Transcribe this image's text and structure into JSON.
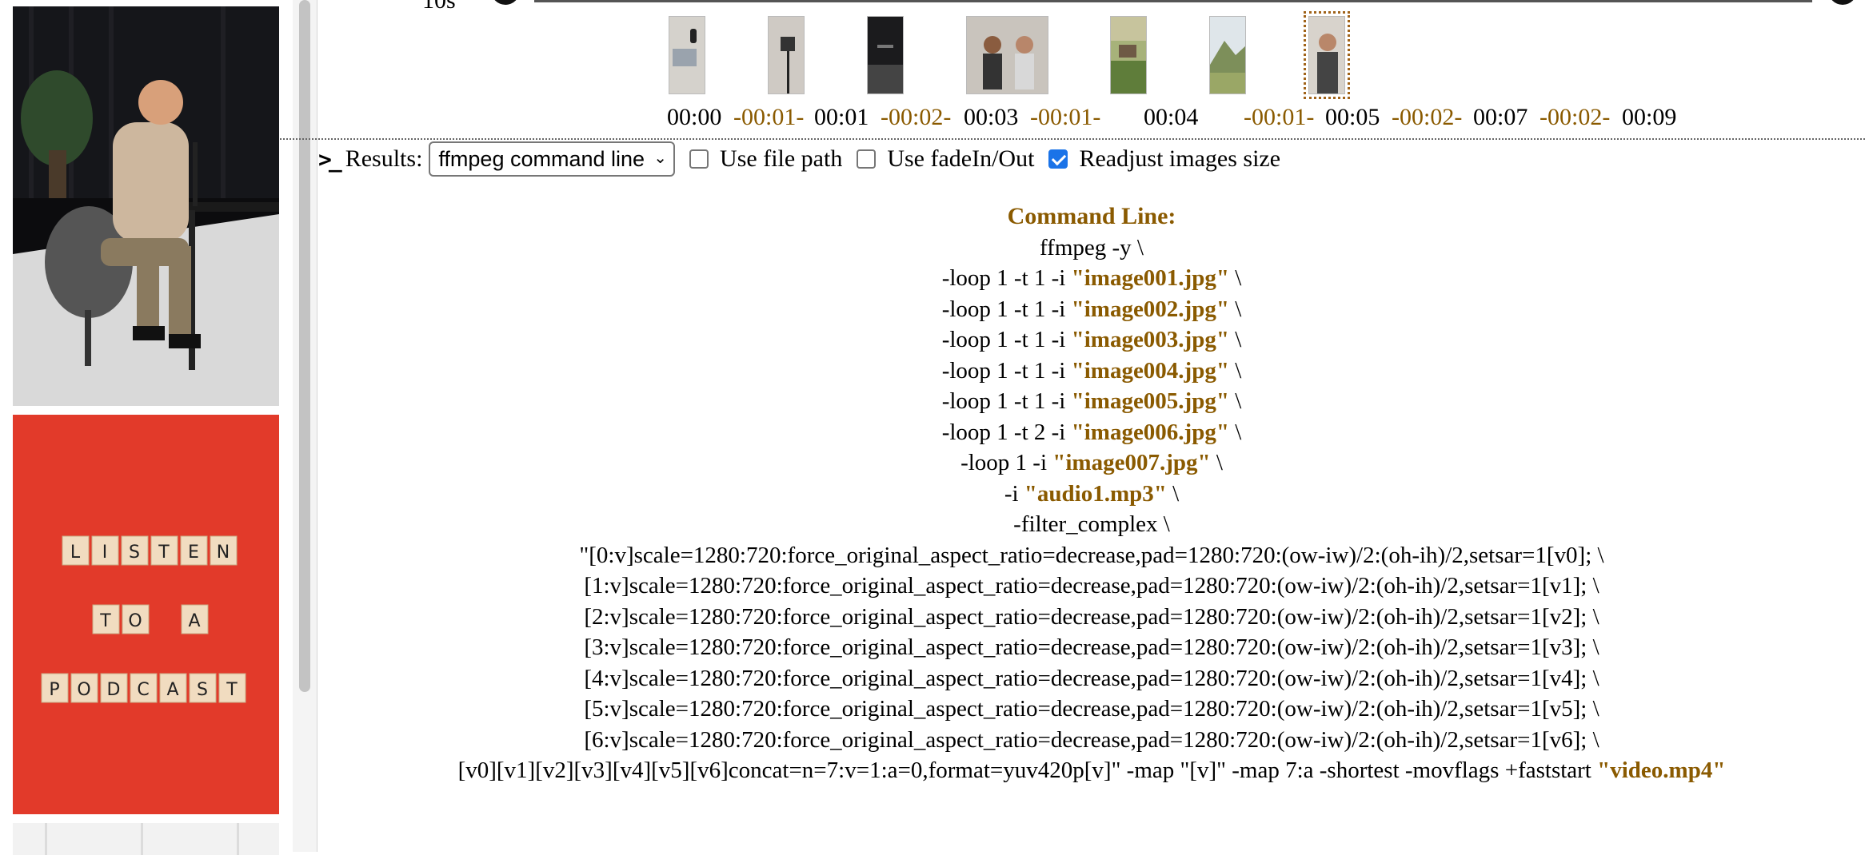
{
  "gallery": {
    "photos": [
      {
        "icon": "podcaster-photo"
      },
      {
        "icon": "listen-to-a-podcast-tiles-photo",
        "tile_rows": [
          [
            "L",
            "I",
            "S",
            "T",
            "E",
            "N"
          ],
          [
            "T",
            "O",
            "",
            "A"
          ],
          [
            "P",
            "O",
            "D",
            "C",
            "A",
            "S",
            "T"
          ]
        ]
      },
      {
        "icon": "partial-photo"
      }
    ]
  },
  "timeline": {
    "ruler_label": "10s",
    "clips": [
      {
        "time": "00:00",
        "dur": "-00:01-"
      },
      {
        "time": "00:01",
        "dur": "-00:02-"
      },
      {
        "time": "00:03",
        "dur": "-00:01-"
      },
      {
        "time": "00:04",
        "dur": "-00:01-"
      },
      {
        "time": "00:05",
        "dur": "-00:02-"
      },
      {
        "time": "00:07",
        "dur": "-00:02-"
      },
      {
        "time": "00:09",
        "dur": ""
      }
    ],
    "selected_index": 6
  },
  "toolbar": {
    "results_label": "Results:",
    "select_value": "ffmpeg command line",
    "use_file_path": {
      "label": "Use file path",
      "checked": false
    },
    "use_fade": {
      "label": "Use fadeIn/Out",
      "checked": false
    },
    "readjust": {
      "label": "Readjust images size",
      "checked": true
    }
  },
  "command": {
    "title": "Command Line:",
    "l_ffmpeg": "ffmpeg -y \\",
    "inputs": [
      {
        "pre": "-loop 1 -t 1 -i ",
        "file": "\"image001.jpg\"",
        "post": " \\"
      },
      {
        "pre": "-loop 1 -t 1 -i ",
        "file": "\"image002.jpg\"",
        "post": " \\"
      },
      {
        "pre": "-loop 1 -t 1 -i ",
        "file": "\"image003.jpg\"",
        "post": " \\"
      },
      {
        "pre": "-loop 1 -t 1 -i ",
        "file": "\"image004.jpg\"",
        "post": " \\"
      },
      {
        "pre": "-loop 1 -t 1 -i ",
        "file": "\"image005.jpg\"",
        "post": " \\"
      },
      {
        "pre": "-loop 1 -t 2 -i ",
        "file": "\"image006.jpg\"",
        "post": " \\"
      },
      {
        "pre": "-loop 1 -i ",
        "file": "\"image007.jpg\"",
        "post": " \\"
      },
      {
        "pre": "-i ",
        "file": "\"audio1.mp3\"",
        "post": " \\"
      }
    ],
    "l_filter": "-filter_complex \\",
    "filters": [
      "\"[0:v]scale=1280:720:force_original_aspect_ratio=decrease,pad=1280:720:(ow-iw)/2:(oh-ih)/2,setsar=1[v0]; \\",
      "[1:v]scale=1280:720:force_original_aspect_ratio=decrease,pad=1280:720:(ow-iw)/2:(oh-ih)/2,setsar=1[v1]; \\",
      "[2:v]scale=1280:720:force_original_aspect_ratio=decrease,pad=1280:720:(ow-iw)/2:(oh-ih)/2,setsar=1[v2]; \\",
      "[3:v]scale=1280:720:force_original_aspect_ratio=decrease,pad=1280:720:(ow-iw)/2:(oh-ih)/2,setsar=1[v3]; \\",
      "[4:v]scale=1280:720:force_original_aspect_ratio=decrease,pad=1280:720:(ow-iw)/2:(oh-ih)/2,setsar=1[v4]; \\",
      "[5:v]scale=1280:720:force_original_aspect_ratio=decrease,pad=1280:720:(ow-iw)/2:(oh-ih)/2,setsar=1[v5]; \\",
      "[6:v]scale=1280:720:force_original_aspect_ratio=decrease,pad=1280:720:(ow-iw)/2:(oh-ih)/2,setsar=1[v6]; \\"
    ],
    "concat_pre": "[v0][v1][v2][v3][v4][v5][v6]concat=n=7:v=1:a=0,format=yuv420p[v]\" -map \"[v]\" -map 7:a -shortest -movflags +faststart ",
    "output_file": "\"video.mp4\""
  }
}
